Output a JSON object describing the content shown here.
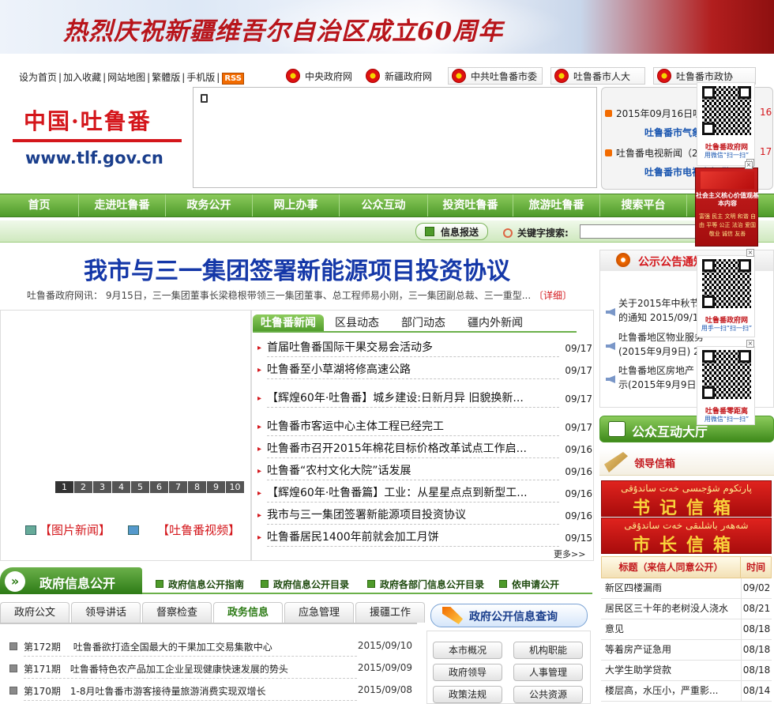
{
  "banner": {
    "text": "热烈庆祝新疆维吾尔自治区成立60周年"
  },
  "toplinks": [
    "设为首页",
    "加入收藏",
    "网站地图",
    "繁體版",
    "手机版"
  ],
  "rss": "RSS",
  "govlinks": [
    "中央政府网",
    "新疆政府网",
    "中共吐鲁番市委",
    "吐鲁番市人大",
    "吐鲁番市政协"
  ],
  "logo": {
    "cn": "中国·吐鲁番",
    "url": "www.tlf.gov.cn"
  },
  "weather": {
    "row1": "2015年09月16日吐鲁番",
    "row1_date": "16",
    "link1": "吐鲁番市气象",
    "row2": "吐鲁番电视新闻（2",
    "row2_date": "17",
    "link2": "吐鲁番市电视台提供"
  },
  "nav": [
    "首页",
    "走进吐鲁番",
    "政务公开",
    "网上办事",
    "公众互动",
    "投资吐鲁番",
    "旅游吐鲁番",
    "搜索平台"
  ],
  "subnav": {
    "info_button": "信息报送",
    "keyword_label": "关键字搜索:",
    "keyword_value": ""
  },
  "headline": {
    "title": "我市与三一集团签署新能源项目投资协议",
    "summary": "吐鲁番政府网讯： 9月15日，三一集团董事长梁稳根带领三一集团董事、总工程师易小刚，三一集团副总裁、三一重型...",
    "detail": "〔详细〕"
  },
  "slideshow": {
    "pages": [
      "1",
      "2",
      "3",
      "4",
      "5",
      "6",
      "7",
      "8",
      "9",
      "10"
    ]
  },
  "picnews": "【图片新闻】",
  "vidnews": "【吐鲁番视频】",
  "newstabs": [
    "吐鲁番新闻",
    "区县动态",
    "部门动态",
    "疆内外新闻"
  ],
  "news": [
    {
      "title": "首届吐鲁番国际干果交易会活动多",
      "date": "09/17"
    },
    {
      "title": "吐鲁番至小草湖将修高速公路",
      "date": "09/17"
    },
    {
      "title": "【辉煌60年·吐鲁番】城乡建设:日新月异 旧貌换新...",
      "date": "09/17"
    },
    {
      "title": "吐鲁番市客运中心主体工程已经完工",
      "date": "09/17"
    },
    {
      "title": "吐鲁番市召开2015年棉花目标价格改革试点工作启...",
      "date": "09/16"
    },
    {
      "title": "吐鲁番“农村文化大院”话发展",
      "date": "09/16"
    },
    {
      "title": "【辉煌60年·吐鲁番篇】工业：从星星点点到新型工...",
      "date": "09/16"
    },
    {
      "title": "我市与三一集团签署新能源项目投资协议",
      "date": "09/16"
    },
    {
      "title": "吐鲁番居民1400年前就会加工月饼",
      "date": "09/15"
    }
  ],
  "more": "更多>>",
  "notice": {
    "title": "公示公告通知",
    "items": [
      {
        "text": "关于2015年中秋节",
        "tail": "的通知 2015/09/16"
      },
      {
        "text": "吐鲁番地区物业服务",
        "tail": "(2015年9月9日) 20"
      },
      {
        "text": "吐鲁番地区房地产",
        "tail": "示(2015年9月9日)"
      }
    ]
  },
  "hudong": "公众互动大厅",
  "leader_mailbox": "领导信箱",
  "mailbox1": {
    "ug": "پارتكوم شۇجىسى خەت ساندۇقى",
    "cn": "书记信箱"
  },
  "mailbox2": {
    "ug": "شەھەر باشلىقى خەت ساندۇقى",
    "cn": "市长信箱"
  },
  "letters": {
    "header_title": "标题（来信人同意公开）",
    "header_date": "时间",
    "rows": [
      {
        "title": "新区四楼漏雨",
        "date": "09/02"
      },
      {
        "title": "居民区三十年的老树没人浇水",
        "date": "08/21"
      },
      {
        "title": "意见",
        "date": "08/18"
      },
      {
        "title": "等着房产证急用",
        "date": "08/18"
      },
      {
        "title": "大学生助学贷款",
        "date": "08/18"
      },
      {
        "title": "楼层高，水压小，严重影...",
        "date": "08/14"
      }
    ]
  },
  "govinfo": {
    "title": "政府信息公开",
    "links": [
      "政府信息公开指南",
      "政府信息公开目录",
      "政府各部门信息公开目录",
      "依申请公开"
    ],
    "tabs": [
      "政府公文",
      "领导讲话",
      "督察检查",
      "政务信息",
      "应急管理",
      "援疆工作"
    ],
    "active_tab": "政务信息",
    "rows": [
      {
        "title": "第172期　 吐鲁番欲打造全国最大的干果加工交易集散中心",
        "date": "2015/09/10"
      },
      {
        "title": "第171期　吐鲁番特色农产品加工企业呈现健康快速发展的势头",
        "date": "2015/09/09"
      },
      {
        "title": "第170期　1-8月吐鲁番市游客接待量旅游消费实现双增长",
        "date": "2015/09/08"
      }
    ]
  },
  "query": {
    "title": "政府公开信息查询",
    "buttons": [
      "本市概况",
      "机构职能",
      "政府领导",
      "人事管理",
      "政策法规",
      "公共资源"
    ]
  },
  "floaters": {
    "qr1_cap": "吐鲁番政府网",
    "qr1_cap2": "用微信“扫一扫”",
    "qr2_cap": "吐鲁番政府网",
    "qr2_cap2": "用手一扫“扫一扫”",
    "qr3_cap": "吐鲁番零距离",
    "qr3_cap2": "用微信“扫一扫”",
    "coreval_title": "社会主义核心价值观基本内容",
    "coreval_items": "富强 民主 文明 和谐 自由 平等 公正 法治 爱国 敬业 诚信 友善",
    "close": "×"
  }
}
